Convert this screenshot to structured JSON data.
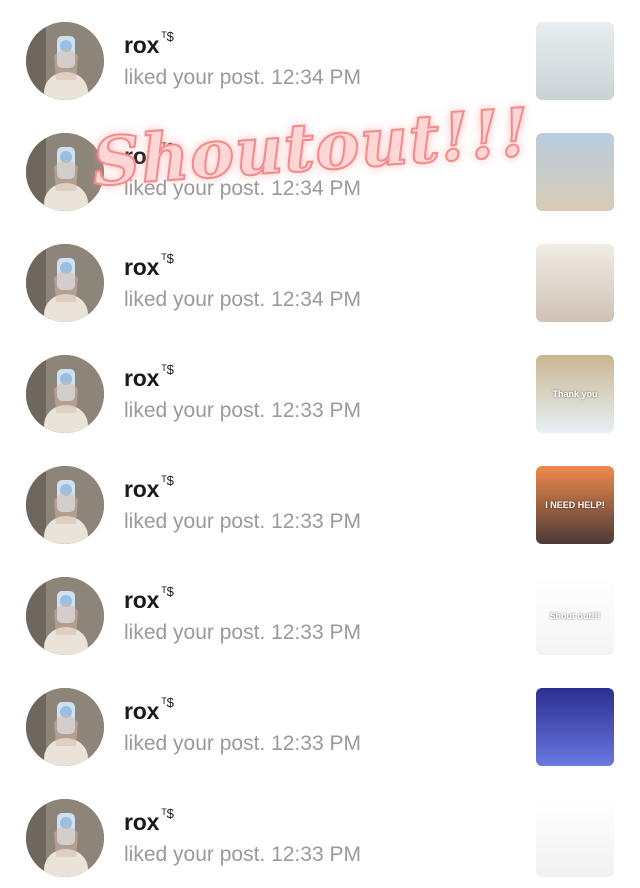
{
  "notifications": [
    {
      "username": "rox",
      "badge": "ᵀ$",
      "activity": "liked your post. 12:34 PM",
      "thumb": {
        "caption": "",
        "icon": "skincare-bottles-thumbnail",
        "bg": [
          "#e8eef0",
          "#c9d3d6"
        ]
      }
    },
    {
      "username": "rox",
      "badge": "ᵀ$",
      "activity": "liked your post. 12:34 PM",
      "thumb": {
        "caption": "",
        "icon": "beach-thumbnail",
        "bg": [
          "#b9cde0",
          "#d8cbb4"
        ]
      }
    },
    {
      "username": "rox",
      "badge": "ᵀ$",
      "activity": "liked your post. 12:34 PM",
      "thumb": {
        "caption": "",
        "icon": "perfume-thumbnail",
        "bg": [
          "#f1ece6",
          "#cfc2b5"
        ]
      }
    },
    {
      "username": "rox",
      "badge": "ᵀ$",
      "activity": "liked your post. 12:33 PM",
      "thumb": {
        "caption": "Thank you",
        "icon": "tulip-field-thumbnail",
        "bg": [
          "#c9b690",
          "#e7f0f7"
        ]
      }
    },
    {
      "username": "rox",
      "badge": "ᵀ$",
      "activity": "liked your post. 12:33 PM",
      "thumb": {
        "caption": "I NEED HELP!",
        "icon": "sunset-path-thumbnail",
        "bg": [
          "#f08a4b",
          "#4a3a38"
        ]
      }
    },
    {
      "username": "rox",
      "badge": "ᵀ$",
      "activity": "liked your post. 12:33 PM",
      "thumb": {
        "caption": "Shout out!!!",
        "icon": "shoutout-list-thumbnail",
        "bg": [
          "#ffffff",
          "#f4f4f4"
        ]
      }
    },
    {
      "username": "rox",
      "badge": "ᵀ$",
      "activity": "liked your post. 12:33 PM",
      "thumb": {
        "caption": "",
        "icon": "jellyfish-thumbnail",
        "bg": [
          "#2b2f8f",
          "#6a78e0"
        ]
      }
    },
    {
      "username": "rox",
      "badge": "ᵀ$",
      "activity": "liked your post. 12:33 PM",
      "thumb": {
        "caption": "",
        "icon": "stats-thumbnail",
        "bg": [
          "#ffffff",
          "#f1f1f1"
        ]
      }
    }
  ],
  "overlay": {
    "text": "Shoutout!!!"
  },
  "colors": {
    "username": "#1a1a1a",
    "activity": "#9a9a9a",
    "overlay_fill": "#ffd6d6",
    "overlay_stroke": "#f28b8b"
  }
}
